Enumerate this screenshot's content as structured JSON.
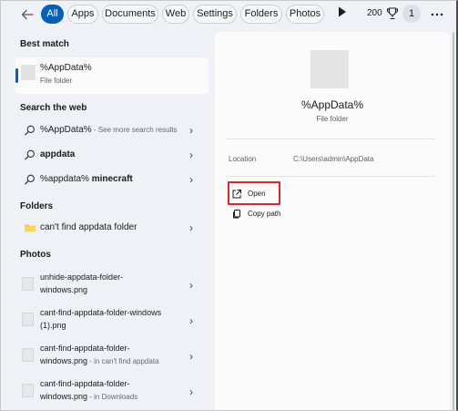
{
  "topbar": {
    "back_icon": "back-arrow-icon",
    "tabs": [
      {
        "label": "All",
        "active": true
      },
      {
        "label": "Apps"
      },
      {
        "label": "Documents"
      },
      {
        "label": "Web"
      },
      {
        "label": "Settings"
      },
      {
        "label": "Folders"
      },
      {
        "label": "Photos"
      }
    ],
    "play_icon": "play-icon",
    "points": "200",
    "trophy_icon": "trophy-icon",
    "account_initial": "1",
    "more_icon": "more-icon"
  },
  "left": {
    "best_match": {
      "heading": "Best match",
      "title": "%AppData%",
      "subtitle": "File folder",
      "accent_color": "#005fb8"
    },
    "web": {
      "heading": "Search the web",
      "items": [
        {
          "main": "%AppData%",
          "sub": " - See more search results"
        },
        {
          "main": "appdata",
          "sub": ""
        },
        {
          "main": "%appdata% ",
          "bold": "minecraft"
        }
      ]
    },
    "folders": {
      "heading": "Folders",
      "items": [
        {
          "label": "can't find appdata folder"
        }
      ]
    },
    "photos": {
      "heading": "Photos",
      "items": [
        {
          "line1": "unhide-appdata-folder-",
          "line2": "windows.png",
          "sub": ""
        },
        {
          "line1": "cant-find-appdata-folder-windows",
          "line2": "(1).png",
          "sub": ""
        },
        {
          "line1": "cant-find-appdata-folder-",
          "line2": "windows.png",
          "sub": " - in can't find appdata"
        },
        {
          "line1": "cant-find-appdata-folder-",
          "line2": "windows.png",
          "sub": " - in Downloads"
        }
      ]
    }
  },
  "detail": {
    "title": "%AppData%",
    "subtitle": "File folder",
    "location_label": "Location",
    "location_value": "C:\\Users\\admin\\AppData",
    "actions": [
      {
        "label": "Open",
        "icon": "open-external-icon"
      },
      {
        "label": "Copy path",
        "icon": "copy-icon"
      }
    ],
    "highlight_color": "#d6272f"
  }
}
